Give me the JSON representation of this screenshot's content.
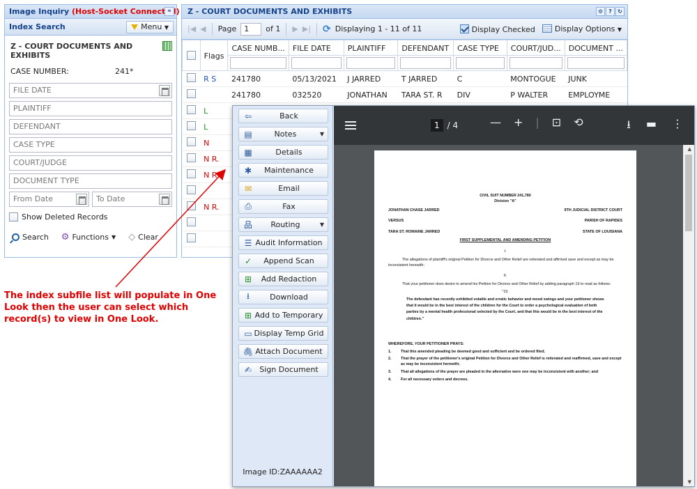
{
  "left_panel": {
    "title": "Image Inquiry",
    "status": "(Host-Socket Connected)",
    "collapse_label": "«",
    "section_title": "Index Search",
    "menu_label": "Menu",
    "doc_title": "Z - COURT DOCUMENTS AND EXHIBITS",
    "case_number_label": "CASE NUMBER:",
    "case_number_value": "241*",
    "fields": [
      "FILE DATE",
      "PLAINTIFF",
      "DEFENDANT",
      "CASE TYPE",
      "COURT/JUDGE",
      "DOCUMENT TYPE"
    ],
    "from_date": "From Date",
    "to_date": "To Date",
    "show_deleted": "Show Deleted Records",
    "actions": {
      "search": "Search",
      "functions": "Functions",
      "clear": "Clear"
    }
  },
  "grid_panel": {
    "title": "Z - COURT DOCUMENTS AND EXHIBITS",
    "page_label": "Page",
    "page_value": "1",
    "of_label": "of 1",
    "displaying": "Displaying 1 - 11 of 11",
    "display_checked": "Display Checked",
    "display_options": "Display Options",
    "columns": [
      "Flags",
      "CASE NUMB...",
      "FILE DATE",
      "PLAINTIFF",
      "DEFENDANT",
      "CASE TYPE",
      "COURT/JUD...",
      "DOCUMENT ..."
    ],
    "rows": [
      {
        "flags": "R S",
        "flag_color": "blue",
        "case": "241780",
        "date": "05/13/2021",
        "plaintiff": "J JARRED",
        "defendant": "T JARRED",
        "type": "C",
        "court": "MONTOGUE",
        "doc": "JUNK"
      },
      {
        "flags": "",
        "flag_color": "blue",
        "case": "241780",
        "date": "032520",
        "plaintiff": "JONATHAN",
        "defendant": "TARA ST. R",
        "type": "DIV",
        "court": "P WALTER",
        "doc": "EMPLOYME"
      },
      {
        "flags": "L",
        "flag_color": "green",
        "case": "",
        "date": "",
        "plaintiff": "",
        "defendant": "",
        "type": "",
        "court": "",
        "doc": ""
      },
      {
        "flags": "L",
        "flag_color": "green",
        "case": "",
        "date": "",
        "plaintiff": "",
        "defendant": "",
        "type": "",
        "court": "",
        "doc": ""
      },
      {
        "flags": "N",
        "flag_color": "red",
        "case": "",
        "date": "",
        "plaintiff": "",
        "defendant": "",
        "type": "",
        "court": "",
        "doc": ""
      },
      {
        "flags": "N R.",
        "flag_color": "mixed",
        "case": "",
        "date": "",
        "plaintiff": "",
        "defendant": "",
        "type": "",
        "court": "",
        "doc": ""
      },
      {
        "flags": "N R",
        "flag_color": "mixed",
        "case": "",
        "date": "",
        "plaintiff": "",
        "defendant": "",
        "type": "",
        "court": "",
        "doc": ""
      },
      {
        "flags": "",
        "flag_color": "blue",
        "case": "",
        "date": "",
        "plaintiff": "",
        "defendant": "",
        "type": "",
        "court": "",
        "doc": ""
      },
      {
        "flags": "N R.",
        "flag_color": "mixed",
        "case": "",
        "date": "",
        "plaintiff": "",
        "defendant": "",
        "type": "",
        "court": "",
        "doc": ""
      },
      {
        "flags": "",
        "flag_color": "blue",
        "case": "",
        "date": "",
        "plaintiff": "",
        "defendant": "",
        "type": "",
        "court": "",
        "doc": ""
      },
      {
        "flags": "",
        "flag_color": "blue",
        "case": "",
        "date": "",
        "plaintiff": "",
        "defendant": "",
        "type": "",
        "court": "",
        "doc": ""
      }
    ]
  },
  "viewer": {
    "buttons": [
      {
        "label": "Back",
        "icon": "back-arrow-icon",
        "dropdown": false
      },
      {
        "label": "Notes",
        "icon": "notes-icon",
        "dropdown": true
      },
      {
        "label": "Details",
        "icon": "details-icon",
        "dropdown": false
      },
      {
        "label": "Maintenance",
        "icon": "maintenance-icon",
        "dropdown": false
      },
      {
        "label": "Email",
        "icon": "email-icon",
        "dropdown": false
      },
      {
        "label": "Fax",
        "icon": "fax-icon",
        "dropdown": false
      },
      {
        "label": "Routing",
        "icon": "routing-icon",
        "dropdown": true
      },
      {
        "label": "Audit Information",
        "icon": "audit-icon",
        "dropdown": false
      },
      {
        "label": "Append Scan",
        "icon": "append-scan-icon",
        "dropdown": false
      },
      {
        "label": "Add Redaction",
        "icon": "add-redaction-icon",
        "dropdown": false
      },
      {
        "label": "Download",
        "icon": "download-icon",
        "dropdown": false
      },
      {
        "label": "Add to Temporary",
        "icon": "add-temporary-icon",
        "dropdown": false
      },
      {
        "label": "Display Temp Grid",
        "icon": "temp-grid-icon",
        "dropdown": false
      },
      {
        "label": "Attach Document",
        "icon": "paperclip-icon",
        "dropdown": false
      },
      {
        "label": "Sign Document",
        "icon": "signature-icon",
        "dropdown": false
      }
    ],
    "image_id": "Image ID:ZAAAAAA2",
    "pdf": {
      "current_page": "1",
      "total_pages": "/ 4"
    },
    "document": {
      "heading1": "CIVIL SUIT NUMBER 241,780",
      "heading2": "Division \"A\"",
      "plaintiff": "JONATHAN CHASE JARRED",
      "court": "9TH JUDICIAL DISTRICT COURT",
      "versus": "VERSUS",
      "parish": "PARISH OF RAPIDES",
      "defendant": "TARA ST. ROMAINE JARRED",
      "state": "STATE OF LOUISIANA",
      "petition_title": "FIRST SUPPLEMENTAL AND AMENDING PETITION",
      "sec1": "I.",
      "para1": "The allegations of plaintiff's original Petition for Divorce and Other Relief are reiterated and affirmed save and except as may be inconsistent herewith;",
      "sec2": "II.",
      "para2": "That your petitioner does desire to amend his Petition for Divorce and Other Relief by adding paragraph 19 to read as follows:",
      "quote_num": "\"19.",
      "quote": "The defendant has recently exhibited volatile and erratic behavior and mood swings and your petitioner shows that it would be in the best interest of the children for the Court to order a psychological evaluation of both parties by a mental health professional selected by the Court, and that this would be in the best interest of the children.\"",
      "prays": "WHEREFORE, YOUR PETITIONER PRAYS:",
      "items": [
        "That this amended pleading be deemed good and sufficient and be ordered filed;",
        "That the prayer of the petitioner's original Petition for Divorce and Other Relief is reiterated and reaffirmed, save and except as may be inconsistent herewith;",
        "That all allegations of the prayer are pleaded in the alternative were one may be inconsistent with another; and",
        "For all necessary orders and decrees."
      ]
    }
  },
  "annotation": {
    "text": "The index subfile list will populate in One Look then the user can select which record(s) to view in One Look.",
    "color": "#e00000"
  },
  "colors": {
    "panel_header": "#15428b",
    "panel_bg": "#dfe8f6",
    "pdf_toolbar": "#323639",
    "pdf_bg": "#525659"
  }
}
